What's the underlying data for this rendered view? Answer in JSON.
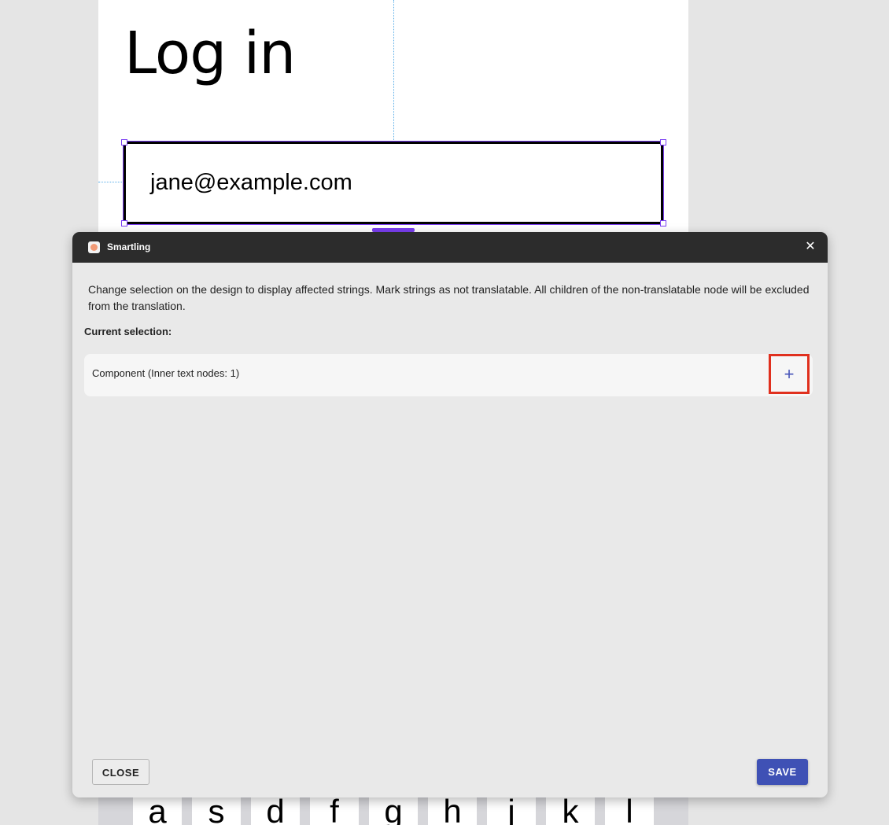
{
  "canvas": {
    "page_title": "Log in",
    "email_value": "jane@example.com",
    "keyboard_keys": [
      "a",
      "s",
      "d",
      "f",
      "g",
      "h",
      "j",
      "k",
      "l"
    ]
  },
  "dialog": {
    "title": "Smartling",
    "close_glyph": "✕",
    "description": "Change selection on the design to display affected strings. Mark strings as not translatable. All children of the non-translatable node will be excluded from the translation.",
    "current_selection_label": "Current selection:",
    "selection_items": [
      {
        "label": "Component (Inner text nodes: 1)",
        "action_glyph": "+"
      }
    ],
    "close_button_label": "CLOSE",
    "save_button_label": "SAVE"
  },
  "colors": {
    "accent": "#3f51b5",
    "highlight": "#e0301e",
    "selection": "#7b3ff2",
    "titlebar": "#2c2c2c"
  },
  "icons": {
    "app_logo": "smartling-logo-icon",
    "close": "close-icon",
    "add": "plus-icon"
  }
}
